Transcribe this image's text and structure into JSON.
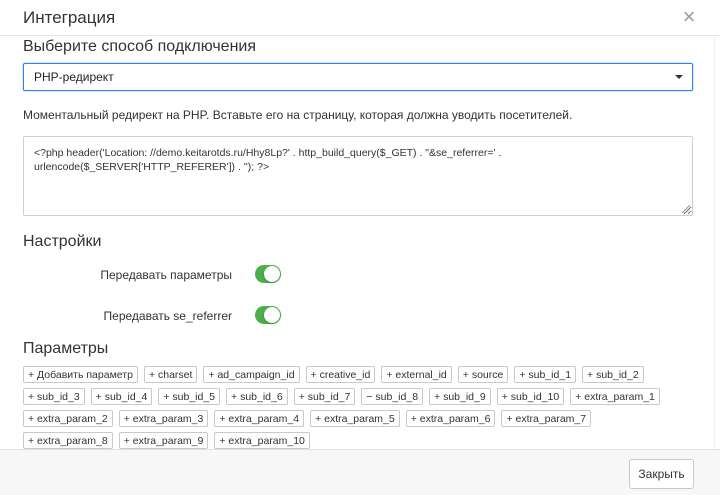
{
  "header": {
    "title": "Интеграция",
    "close_icon": "close-icon"
  },
  "connection": {
    "heading": "Выберите способ подключения",
    "selected": "PHP-редирект",
    "description": "Моментальный редирект на PHP. Вставьте его на страницу, которая должна уводить посетителей.",
    "code": "<?php header('Location: //demo.keitarotds.ru/Hhy8Lp?' . http_build_query($_GET) . \"&se_referrer=' . urlencode($_SERVER['HTTP_REFERER']) . ''); ?>"
  },
  "settings": {
    "heading": "Настройки",
    "items": [
      {
        "label": "Передавать параметры",
        "enabled": true
      },
      {
        "label": "Передавать se_referrer",
        "enabled": true
      }
    ],
    "toggle_color": "#4cae4c"
  },
  "params": {
    "heading": "Параметры",
    "chips": [
      "+ Добавить параметр",
      "+ charset",
      "+ ad_campaign_id",
      "+ creative_id",
      "+ external_id",
      "+ source",
      "+ sub_id_1",
      "+ sub_id_2",
      "+ sub_id_3",
      "+ sub_id_4",
      "+ sub_id_5",
      "+ sub_id_6",
      "+ sub_id_7",
      "− sub_id_8",
      "+ sub_id_9",
      "+ sub_id_10",
      "+ extra_param_1",
      "+ extra_param_2",
      "+ extra_param_3",
      "+ extra_param_4",
      "+ extra_param_5",
      "+ extra_param_6",
      "+ extra_param_7",
      "+ extra_param_8",
      "+ extra_param_9",
      "+ extra_param_10"
    ]
  },
  "footer": {
    "close_label": "Закрыть"
  },
  "colors": {
    "accent": "#2d7ff9",
    "footer_bg": "#f7f7f7"
  }
}
